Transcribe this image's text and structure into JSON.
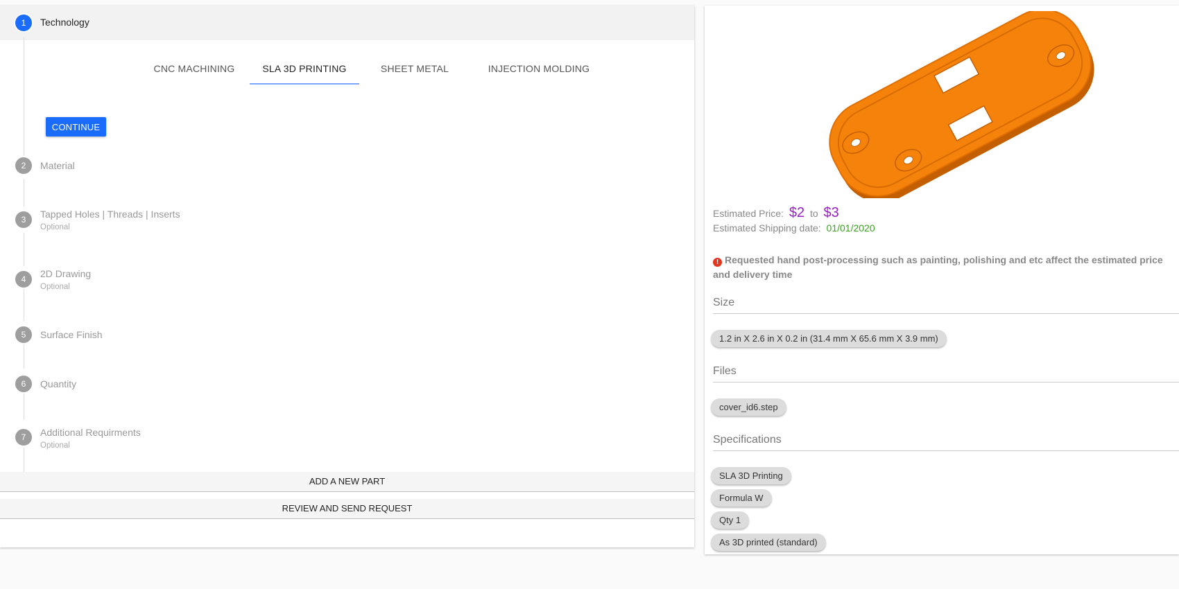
{
  "steps": [
    {
      "num": "1",
      "title": "Technology",
      "sub": ""
    },
    {
      "num": "2",
      "title": "Material",
      "sub": ""
    },
    {
      "num": "3",
      "title": "Tapped Holes | Threads | Inserts",
      "sub": "Optional"
    },
    {
      "num": "4",
      "title": "2D Drawing",
      "sub": "Optional"
    },
    {
      "num": "5",
      "title": "Surface Finish",
      "sub": ""
    },
    {
      "num": "6",
      "title": "Quantity",
      "sub": ""
    },
    {
      "num": "7",
      "title": "Additional Requirments",
      "sub": "Optional"
    }
  ],
  "tabs": [
    {
      "label": "CNC MACHINING",
      "selected": false
    },
    {
      "label": "SLA 3D PRINTING",
      "selected": true
    },
    {
      "label": "SHEET METAL",
      "selected": false
    },
    {
      "label": "INJECTION MOLDING",
      "selected": false
    }
  ],
  "continue_label": "CONTINUE",
  "add_part_label": "ADD A NEW PART",
  "review_label": "REVIEW AND SEND REQUEST",
  "estimate": {
    "price_label": "Estimated Price:",
    "price_min": "$2",
    "to_label": "to",
    "price_max": "$3",
    "shipping_label": "Estimated Shipping date:",
    "shipping_date": "01/01/2020"
  },
  "notice": {
    "icon": "info-icon",
    "text": "Requested hand post-processing such as painting, polishing and etc affect the estimated price and delivery time"
  },
  "size": {
    "title": "Size",
    "chip": "1.2 in X 2.6 in X 0.2 in (31.4 mm X 65.6 mm X 3.9 mm)"
  },
  "files": {
    "title": "Files",
    "chip": "cover_id6.step"
  },
  "specs": {
    "title": "Specifications",
    "chips": [
      "SLA 3D Printing",
      "Formula W",
      "Qty 1",
      "As 3D printed (standard)"
    ]
  },
  "colors": {
    "accent": "#1a6cff",
    "price": "#9b1fc4",
    "date": "#3aa11f",
    "part": "#f5820a"
  }
}
